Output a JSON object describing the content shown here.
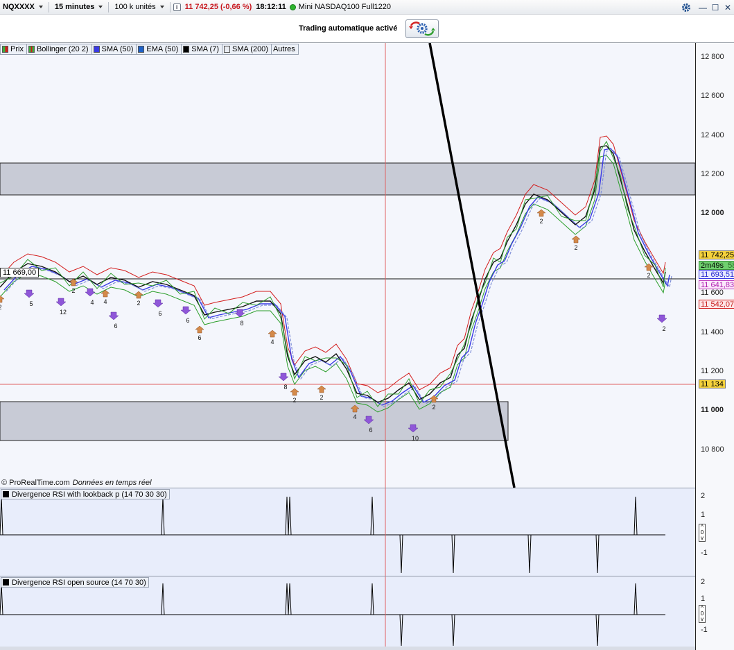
{
  "toolbar": {
    "symbol": "NQXXXX",
    "timeframe": "15 minutes",
    "units": "100 k unités",
    "info_icon": "info-icon",
    "price_change": "11 742,25 (-0,66 %)",
    "time": "18:12:11",
    "instrument": "Mini NASDAQ100 Full1220"
  },
  "window": {
    "icons": [
      "settings-gear-icon",
      "minimize-icon",
      "restore-icon",
      "close-icon"
    ],
    "minimize": "—",
    "restore": "☐",
    "close": "✕"
  },
  "trading": {
    "label": "Trading automatique activé",
    "icon": "auto-trading-gears-icon"
  },
  "legend": [
    {
      "label": "Prix",
      "swatch": "#3cae3c"
    },
    {
      "label": "Bollinger (20 2)",
      "swatch": "#d31c1c"
    },
    {
      "label": "SMA (50)",
      "swatch": "#3a3ae6"
    },
    {
      "label": "EMA (50)",
      "swatch": "#1f62c8"
    },
    {
      "label": "SMA (7)",
      "swatch": "#000000"
    },
    {
      "label": "SMA (200)",
      "swatch": "#e9ecf2"
    },
    {
      "label": "Autres",
      "swatch": ""
    }
  ],
  "credit": {
    "source": "© ProRealTime.com",
    "note": "Données en temps réel"
  },
  "level_label": "11 669,00",
  "price_axis": {
    "ticks": [
      "12 800",
      "12 600",
      "12 400",
      "12 200",
      "12 000",
      "11 600",
      "11 400",
      "11 200",
      "11 000",
      "10 800"
    ],
    "bold_ticks": [
      "12 000",
      "11 000"
    ],
    "tags": {
      "last": "11 742,25",
      "timer": "2m49s",
      "timer_count": "58",
      "sma50": "11 693,51",
      "sma7": "11 641,83",
      "lower": "11 542,07",
      "crosshair": "11 134"
    }
  },
  "panel1": {
    "title": "Divergence RSI with lookback p (14 70 30 30)",
    "ticks": [
      "2",
      "1",
      "-1"
    ],
    "zoom": "0"
  },
  "panel2": {
    "title": "Divergence RSI open source (14 70 30)",
    "ticks": [
      "2",
      "1",
      "-1"
    ],
    "zoom": "0"
  },
  "signals": {
    "sell_counts": [
      "5",
      "12",
      "4",
      "6",
      "6",
      "8",
      "8",
      "4",
      "6",
      "10",
      "2"
    ],
    "buy_counts": [
      "2",
      "2",
      "4",
      "2",
      "6",
      "6",
      "4",
      "2",
      "2",
      "2",
      "2",
      "2",
      "2"
    ]
  },
  "colors": {
    "up": "#2e9e2e",
    "down": "#d32020",
    "sma50": "#3a3ae6",
    "bollinger": "#d31c1c",
    "zone": "#c8cbd6",
    "crosshair": "#e06060"
  }
}
